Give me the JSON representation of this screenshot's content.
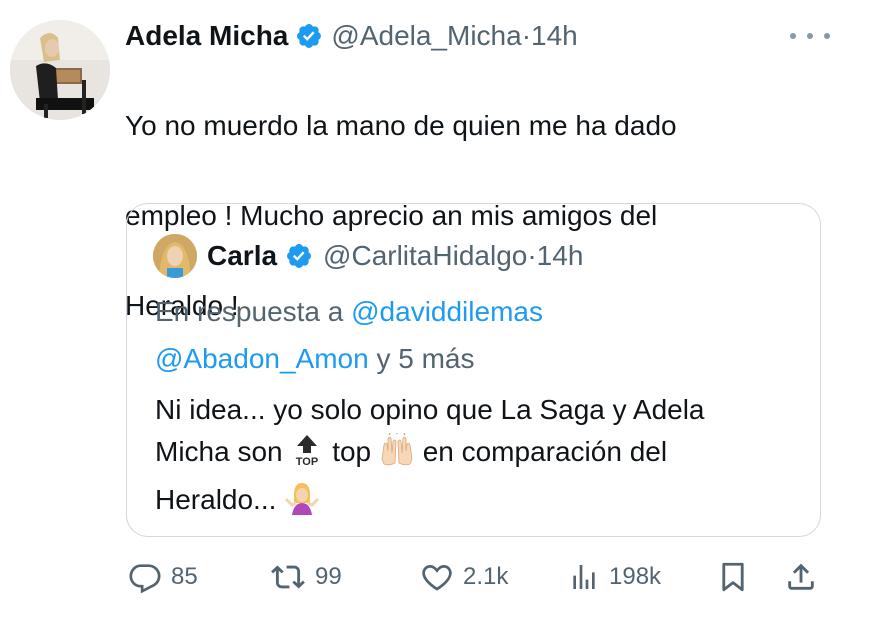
{
  "tweet": {
    "author_name": "Adela Micha",
    "handle": "@Adela_Micha",
    "dot": "·",
    "time": "14h",
    "line1": "Yo no muerdo la mano de quien me ha dado",
    "line2": "empleo  ! Mucho aprecio an mis amigos del",
    "line3": "Heraldo !"
  },
  "quote": {
    "author_name": "Carla",
    "handle": "@CarlitaHidalgo",
    "dot": "·",
    "time": "14h",
    "reply_prefix": "En respuesta a ",
    "reply_user1": "@daviddilemas",
    "reply_user2": "@Abadon_Amon",
    "reply_suffix": " y 5 más",
    "text_line1": "Ni idea... yo solo opino que La Saga y Adela",
    "text_line2_a": "Micha son ",
    "text_top": "top",
    "text_line2_b": "en comparación del",
    "text_line3": "Heraldo... ",
    "top_emoji_label": "TOP"
  },
  "actions": {
    "replies": "85",
    "retweets": "99",
    "likes": "2.1k",
    "views": "198k"
  },
  "icons": {
    "verified": "verified-badge-icon",
    "more": "more-icon",
    "reply": "reply-icon",
    "retweet": "retweet-icon",
    "like": "heart-icon",
    "views": "views-icon",
    "bookmark": "bookmark-icon",
    "share": "share-icon"
  },
  "colors": {
    "link": "#1d9bf0",
    "verified": "#1d9bf0",
    "secondary_text": "#536471"
  }
}
